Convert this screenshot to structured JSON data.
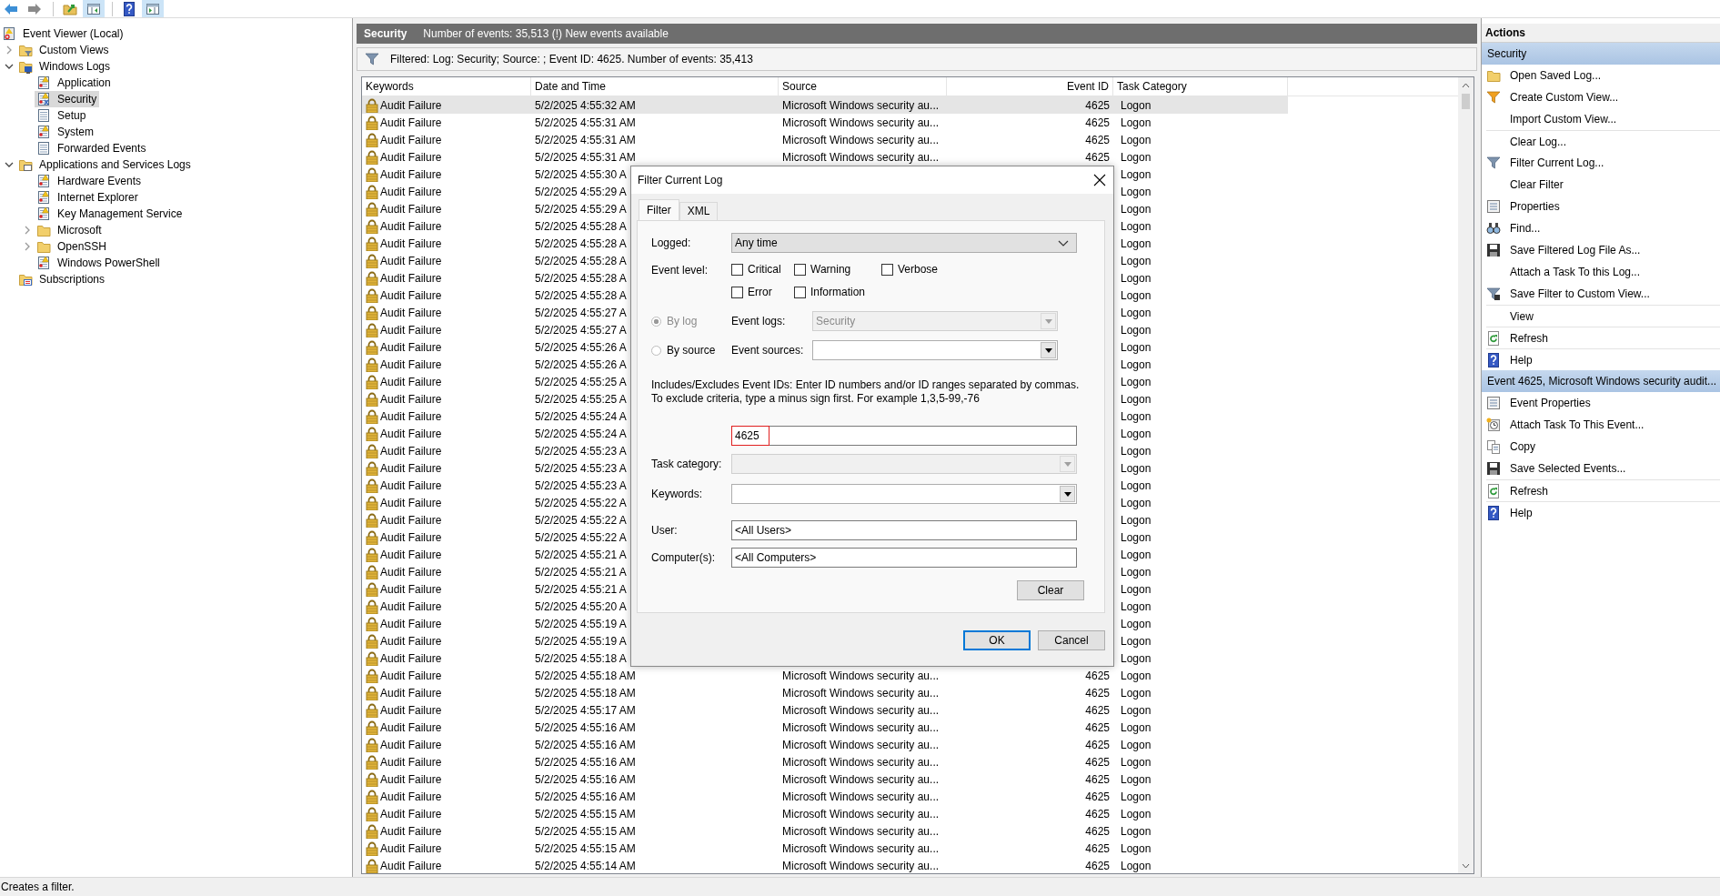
{
  "tree": [
    {
      "label": "Event Viewer (Local)",
      "kind": "viewer",
      "selected": false,
      "children": [
        {
          "label": "Custom Views",
          "kind": "folder-filter",
          "expanded": false,
          "selected": false
        },
        {
          "label": "Windows Logs",
          "kind": "folder-logs",
          "expanded": true,
          "selected": false,
          "children": [
            {
              "label": "Application",
              "kind": "log",
              "selected": false
            },
            {
              "label": "Security",
              "kind": "security-log",
              "selected": true
            },
            {
              "label": "Setup",
              "kind": "plain-log",
              "selected": false
            },
            {
              "label": "System",
              "kind": "log",
              "selected": false
            },
            {
              "label": "Forwarded Events",
              "kind": "plain-log",
              "selected": false
            }
          ]
        },
        {
          "label": "Applications and Services Logs",
          "kind": "folder-apps",
          "expanded": true,
          "selected": false,
          "children": [
            {
              "label": "Hardware Events",
              "kind": "log",
              "selected": false
            },
            {
              "label": "Internet Explorer",
              "kind": "log",
              "selected": false
            },
            {
              "label": "Key Management Service",
              "kind": "log",
              "selected": false
            },
            {
              "label": "Microsoft",
              "kind": "folder",
              "expanded": false,
              "selected": false
            },
            {
              "label": "OpenSSH",
              "kind": "folder",
              "expanded": false,
              "selected": false
            },
            {
              "label": "Windows PowerShell",
              "kind": "log",
              "selected": false
            }
          ]
        },
        {
          "label": "Subscriptions",
          "kind": "subscriptions",
          "selected": false
        }
      ]
    }
  ],
  "log_header": {
    "title": "Security",
    "summary": "Number of events: 35,513 (!) New events available"
  },
  "filter_summary": "Filtered: Log: Security; Source: ; Event ID: 4625. Number of events: 35,413",
  "table": {
    "columns": [
      "Keywords",
      "Date and Time",
      "Source",
      "Event ID",
      "Task Category"
    ],
    "rows": [
      {
        "keywords": "Audit Failure",
        "date_time": "5/2/2025 4:55:32 AM",
        "source": "Microsoft Windows security au...",
        "event_id": "4625",
        "task_category": "Logon",
        "selected": true
      },
      {
        "keywords": "Audit Failure",
        "date_time": "5/2/2025 4:55:31 AM",
        "source": "Microsoft Windows security au...",
        "event_id": "4625",
        "task_category": "Logon",
        "selected": false
      },
      {
        "keywords": "Audit Failure",
        "date_time": "5/2/2025 4:55:31 AM",
        "source": "Microsoft Windows security au...",
        "event_id": "4625",
        "task_category": "Logon",
        "selected": false
      },
      {
        "keywords": "Audit Failure",
        "date_time": "5/2/2025 4:55:31 AM",
        "source": "Microsoft Windows security au...",
        "event_id": "4625",
        "task_category": "Logon",
        "selected": false
      },
      {
        "keywords": "Audit Failure",
        "date_time": "5/2/2025 4:55:30 A",
        "task_category": "Logon",
        "selected": false
      },
      {
        "keywords": "Audit Failure",
        "date_time": "5/2/2025 4:55:29 A",
        "task_category": "Logon",
        "selected": false
      },
      {
        "keywords": "Audit Failure",
        "date_time": "5/2/2025 4:55:29 A",
        "task_category": "Logon",
        "selected": false
      },
      {
        "keywords": "Audit Failure",
        "date_time": "5/2/2025 4:55:28 A",
        "task_category": "Logon",
        "selected": false
      },
      {
        "keywords": "Audit Failure",
        "date_time": "5/2/2025 4:55:28 A",
        "task_category": "Logon",
        "selected": false
      },
      {
        "keywords": "Audit Failure",
        "date_time": "5/2/2025 4:55:28 A",
        "task_category": "Logon",
        "selected": false
      },
      {
        "keywords": "Audit Failure",
        "date_time": "5/2/2025 4:55:28 A",
        "task_category": "Logon",
        "selected": false
      },
      {
        "keywords": "Audit Failure",
        "date_time": "5/2/2025 4:55:28 A",
        "task_category": "Logon",
        "selected": false
      },
      {
        "keywords": "Audit Failure",
        "date_time": "5/2/2025 4:55:27 A",
        "task_category": "Logon",
        "selected": false
      },
      {
        "keywords": "Audit Failure",
        "date_time": "5/2/2025 4:55:27 A",
        "task_category": "Logon",
        "selected": false
      },
      {
        "keywords": "Audit Failure",
        "date_time": "5/2/2025 4:55:26 A",
        "task_category": "Logon",
        "selected": false
      },
      {
        "keywords": "Audit Failure",
        "date_time": "5/2/2025 4:55:26 A",
        "task_category": "Logon",
        "selected": false
      },
      {
        "keywords": "Audit Failure",
        "date_time": "5/2/2025 4:55:25 A",
        "task_category": "Logon",
        "selected": false
      },
      {
        "keywords": "Audit Failure",
        "date_time": "5/2/2025 4:55:25 A",
        "task_category": "Logon",
        "selected": false
      },
      {
        "keywords": "Audit Failure",
        "date_time": "5/2/2025 4:55:24 A",
        "task_category": "Logon",
        "selected": false
      },
      {
        "keywords": "Audit Failure",
        "date_time": "5/2/2025 4:55:24 A",
        "task_category": "Logon",
        "selected": false
      },
      {
        "keywords": "Audit Failure",
        "date_time": "5/2/2025 4:55:23 A",
        "task_category": "Logon",
        "selected": false
      },
      {
        "keywords": "Audit Failure",
        "date_time": "5/2/2025 4:55:23 A",
        "task_category": "Logon",
        "selected": false
      },
      {
        "keywords": "Audit Failure",
        "date_time": "5/2/2025 4:55:23 A",
        "task_category": "Logon",
        "selected": false
      },
      {
        "keywords": "Audit Failure",
        "date_time": "5/2/2025 4:55:22 A",
        "task_category": "Logon",
        "selected": false
      },
      {
        "keywords": "Audit Failure",
        "date_time": "5/2/2025 4:55:22 A",
        "task_category": "Logon",
        "selected": false
      },
      {
        "keywords": "Audit Failure",
        "date_time": "5/2/2025 4:55:22 A",
        "task_category": "Logon",
        "selected": false
      },
      {
        "keywords": "Audit Failure",
        "date_time": "5/2/2025 4:55:21 A",
        "task_category": "Logon",
        "selected": false
      },
      {
        "keywords": "Audit Failure",
        "date_time": "5/2/2025 4:55:21 A",
        "task_category": "Logon",
        "selected": false
      },
      {
        "keywords": "Audit Failure",
        "date_time": "5/2/2025 4:55:21 A",
        "task_category": "Logon",
        "selected": false
      },
      {
        "keywords": "Audit Failure",
        "date_time": "5/2/2025 4:55:20 A",
        "task_category": "Logon",
        "selected": false
      },
      {
        "keywords": "Audit Failure",
        "date_time": "5/2/2025 4:55:19 A",
        "task_category": "Logon",
        "selected": false
      },
      {
        "keywords": "Audit Failure",
        "date_time": "5/2/2025 4:55:19 A",
        "task_category": "Logon",
        "selected": false
      },
      {
        "keywords": "Audit Failure",
        "date_time": "5/2/2025 4:55:18 A",
        "task_category": "Logon",
        "selected": false
      },
      {
        "keywords": "Audit Failure",
        "date_time": "5/2/2025 4:55:18 AM",
        "source": "Microsoft Windows security au...",
        "event_id": "4625",
        "task_category": "Logon",
        "selected": false
      },
      {
        "keywords": "Audit Failure",
        "date_time": "5/2/2025 4:55:18 AM",
        "source": "Microsoft Windows security au...",
        "event_id": "4625",
        "task_category": "Logon",
        "selected": false
      },
      {
        "keywords": "Audit Failure",
        "date_time": "5/2/2025 4:55:17 AM",
        "source": "Microsoft Windows security au...",
        "event_id": "4625",
        "task_category": "Logon",
        "selected": false
      },
      {
        "keywords": "Audit Failure",
        "date_time": "5/2/2025 4:55:16 AM",
        "source": "Microsoft Windows security au...",
        "event_id": "4625",
        "task_category": "Logon",
        "selected": false
      },
      {
        "keywords": "Audit Failure",
        "date_time": "5/2/2025 4:55:16 AM",
        "source": "Microsoft Windows security au...",
        "event_id": "4625",
        "task_category": "Logon",
        "selected": false
      },
      {
        "keywords": "Audit Failure",
        "date_time": "5/2/2025 4:55:16 AM",
        "source": "Microsoft Windows security au...",
        "event_id": "4625",
        "task_category": "Logon",
        "selected": false
      },
      {
        "keywords": "Audit Failure",
        "date_time": "5/2/2025 4:55:16 AM",
        "source": "Microsoft Windows security au...",
        "event_id": "4625",
        "task_category": "Logon",
        "selected": false
      },
      {
        "keywords": "Audit Failure",
        "date_time": "5/2/2025 4:55:16 AM",
        "source": "Microsoft Windows security au...",
        "event_id": "4625",
        "task_category": "Logon",
        "selected": false
      },
      {
        "keywords": "Audit Failure",
        "date_time": "5/2/2025 4:55:15 AM",
        "source": "Microsoft Windows security au...",
        "event_id": "4625",
        "task_category": "Logon",
        "selected": false
      },
      {
        "keywords": "Audit Failure",
        "date_time": "5/2/2025 4:55:15 AM",
        "source": "Microsoft Windows security au...",
        "event_id": "4625",
        "task_category": "Logon",
        "selected": false
      },
      {
        "keywords": "Audit Failure",
        "date_time": "5/2/2025 4:55:15 AM",
        "source": "Microsoft Windows security au...",
        "event_id": "4625",
        "task_category": "Logon",
        "selected": false
      },
      {
        "keywords": "Audit Failure",
        "date_time": "5/2/2025 4:55:14 AM",
        "source": "Microsoft Windows security au...",
        "event_id": "4625",
        "task_category": "Logon",
        "selected": false
      }
    ]
  },
  "dialog": {
    "title": "Filter Current Log",
    "tabs": [
      {
        "label": "Filter",
        "selected": true
      },
      {
        "label": "XML",
        "selected": false
      }
    ],
    "logged": {
      "label": "Logged:",
      "value": "Any time"
    },
    "event_level": {
      "label": "Event level:",
      "options": [
        {
          "label": "Critical",
          "checked": false
        },
        {
          "label": "Warning",
          "checked": false
        },
        {
          "label": "Verbose",
          "checked": false
        },
        {
          "label": "Error",
          "checked": false
        },
        {
          "label": "Information",
          "checked": false
        }
      ]
    },
    "source_mode": [
      {
        "label": "By log",
        "field_label": "Event logs:",
        "value": "Security",
        "selected": true,
        "disabled": true
      },
      {
        "label": "By source",
        "field_label": "Event sources:",
        "selected": false,
        "disabled": false
      }
    ],
    "id_help": "Includes/Excludes Event IDs: Enter ID numbers and/or ID ranges separated by commas. To exclude criteria, type a minus sign first. For example 1,3,5-99,-76",
    "event_ids": {
      "value": "4625",
      "highlighted": true
    },
    "task_category": {
      "label": "Task category:",
      "disabled": true
    },
    "keywords": {
      "label": "Keywords:",
      "disabled": false
    },
    "user": {
      "label": "User:",
      "value": "<All Users>"
    },
    "computers": {
      "label": "Computer(s):",
      "value": "<All Computers>"
    },
    "clear_button": "Clear",
    "footer_buttons": [
      {
        "label": "OK",
        "default": true
      },
      {
        "label": "Cancel",
        "default": false
      }
    ]
  },
  "actions": {
    "title": "Actions",
    "sections": [
      {
        "title": "Security",
        "items": [
          {
            "label": "Open Saved Log...",
            "divider_before": false
          },
          {
            "label": "Create Custom View...",
            "divider_before": false
          },
          {
            "label": "Import Custom View...",
            "divider_before": false
          },
          {
            "label": "Clear Log...",
            "divider_before": true
          },
          {
            "label": "Filter Current Log...",
            "divider_before": false
          },
          {
            "label": "Clear Filter",
            "divider_before": false
          },
          {
            "label": "Properties",
            "divider_before": false
          },
          {
            "label": "Find...",
            "divider_before": false
          },
          {
            "label": "Save Filtered Log File As...",
            "divider_before": false
          },
          {
            "label": "Attach a Task To this Log...",
            "divider_before": false
          },
          {
            "label": "Save Filter to Custom View...",
            "divider_before": false
          },
          {
            "label": "View",
            "divider_before": true
          },
          {
            "label": "Refresh",
            "divider_before": true
          },
          {
            "label": "Help",
            "divider_before": true
          }
        ]
      },
      {
        "title": "Event 4625, Microsoft Windows security audit...",
        "items": [
          {
            "label": "Event Properties",
            "divider_before": false
          },
          {
            "label": "Attach Task To This Event...",
            "divider_before": false
          },
          {
            "label": "Copy",
            "divider_before": false
          },
          {
            "label": "Save Selected Events...",
            "divider_before": false
          },
          {
            "label": "Refresh",
            "divider_before": true
          },
          {
            "label": "Help",
            "divider_before": true
          }
        ]
      }
    ]
  },
  "status_bar": "Creates a filter."
}
